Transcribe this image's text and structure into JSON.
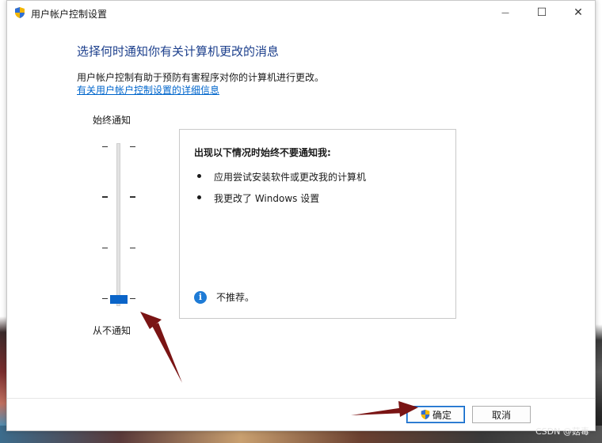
{
  "window": {
    "title": "用户帐户控制设置",
    "controls": {
      "minimize": "—",
      "maximize": "☐",
      "close": "✕"
    }
  },
  "main": {
    "heading": "选择何时通知你有关计算机更改的消息",
    "description": "用户帐户控制有助于预防有害程序对你的计算机进行更改。",
    "link": "有关用户帐户控制设置的详细信息"
  },
  "slider": {
    "top_label": "始终通知",
    "bottom_label": "从不通知",
    "level_count": 4,
    "selected_level": 1,
    "selected_level_note": "1 = bottom position (never notify)"
  },
  "info_box": {
    "title": "出现以下情况时始终不要通知我:",
    "bullets": [
      "应用尝试安装软件或更改我的计算机",
      "我更改了 Windows 设置"
    ],
    "note": "不推荐。"
  },
  "buttons": {
    "ok": "确定",
    "cancel": "取消"
  },
  "watermark": "CSDN @菇毒",
  "colors": {
    "heading": "#1c3f8c",
    "link": "#0066cc",
    "thumb": "#0a64c8",
    "arrow": "#7a1414",
    "info_icon": "#1e7bd6"
  },
  "icons": {
    "title_icon": "uac-shield-icon",
    "ok_icon": "uac-shield-icon",
    "note_icon": "info-icon"
  }
}
